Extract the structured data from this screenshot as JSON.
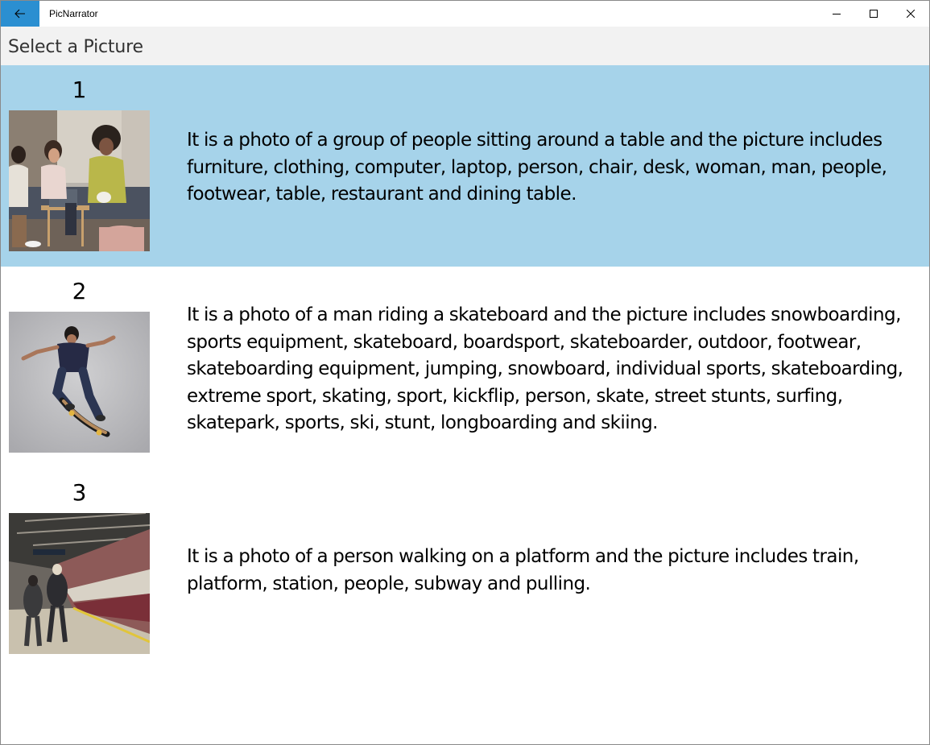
{
  "window": {
    "title": "PicNarrator",
    "back_icon": "arrow-left-icon",
    "minimize_icon": "minimize-icon",
    "maximize_icon": "maximize-icon",
    "close_icon": "close-icon",
    "accent_color": "#2b8fd1"
  },
  "header": {
    "title": "Select a Picture"
  },
  "list": {
    "selected_color": "#a6d3ea",
    "items": [
      {
        "number": "1",
        "description": "It is a photo of a group of people sitting around a table and the picture includes furniture, clothing, computer, laptop, person, chair, desk, woman, man, people, footwear, table, restaurant and dining table.",
        "selected": true
      },
      {
        "number": "2",
        "description": "It is a photo of a man riding a skateboard and the picture includes snowboarding, sports equipment, skateboard, boardsport, skateboarder, outdoor, footwear, skateboarding equipment, jumping, snowboard, individual sports, skateboarding, extreme sport, skating, sport, kickflip, person, skate, street stunts, surfing, skatepark, sports, ski, stunt, longboarding and skiing.",
        "selected": false
      },
      {
        "number": "3",
        "description": "It is a photo of a person walking on a platform and the picture includes train, platform, station, people, subway and pulling.",
        "selected": false
      }
    ]
  }
}
